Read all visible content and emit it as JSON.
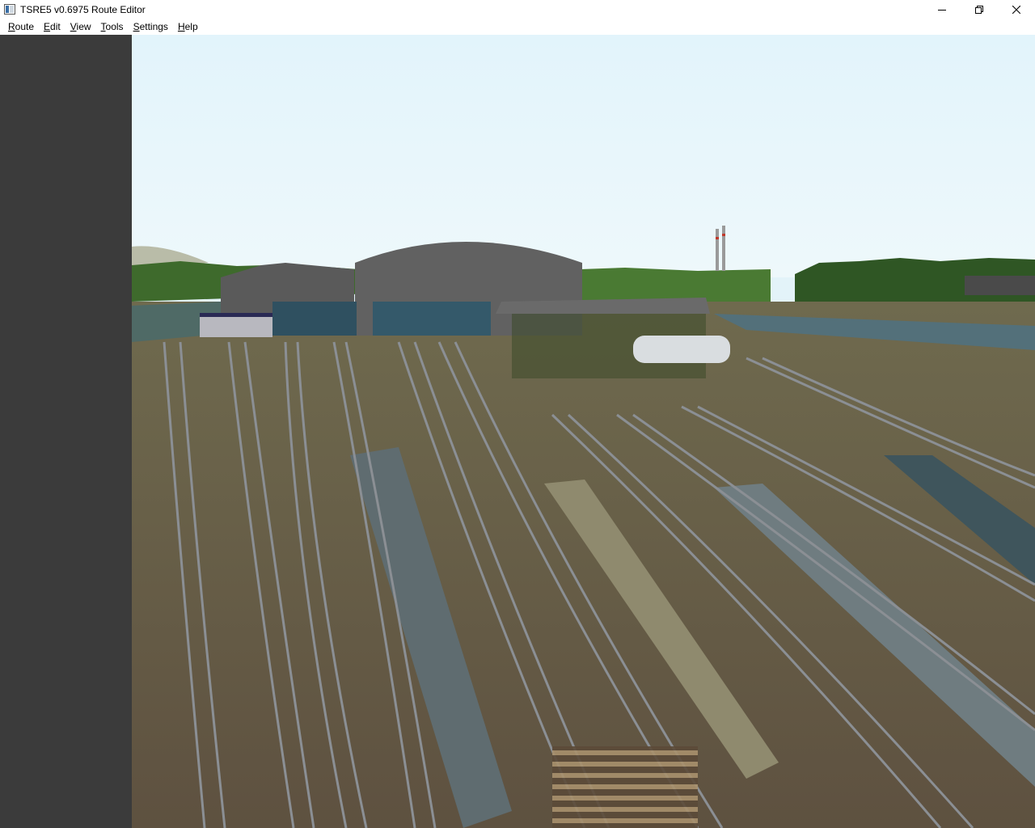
{
  "window": {
    "title": "TSRE5 v0.6975 Route Editor",
    "icons": [
      "app-icon",
      "minimize-icon",
      "restore-icon",
      "close-icon"
    ]
  },
  "menu": {
    "items": [
      {
        "mnemonic": "R",
        "rest": "oute"
      },
      {
        "mnemonic": "E",
        "rest": "dit"
      },
      {
        "mnemonic": "V",
        "rest": "iew"
      },
      {
        "mnemonic": "T",
        "rest": "ools"
      },
      {
        "mnemonic": "S",
        "rest": "ettings"
      },
      {
        "mnemonic": "H",
        "rest": "elp"
      }
    ]
  },
  "viewport": {
    "scene": "3d-route-view",
    "sky_color": "#e3f3f9",
    "ground_color": "#6b5d46"
  },
  "colors": {
    "sidebar": "#3b3b3b",
    "titlebar": "#ffffff"
  }
}
